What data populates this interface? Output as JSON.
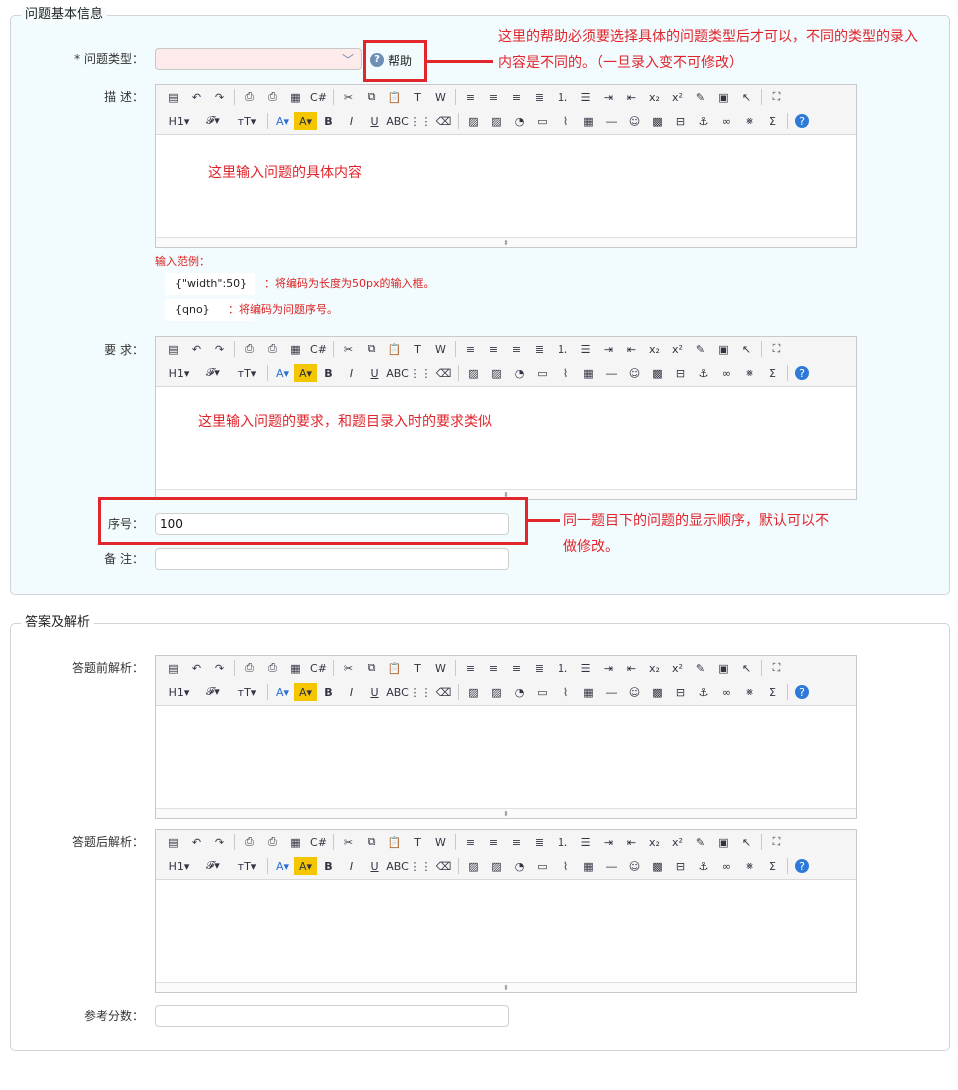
{
  "section1": {
    "legend": "问题基本信息",
    "type_label": "* 问题类型：",
    "help_label": "帮助",
    "help_icon": "question-circle-icon",
    "desc_label": "描 述：",
    "desc_annotation": "这里输入问题的具体内容",
    "sample_title": "输入范例：",
    "samples": [
      {
        "code": "{\"width\":50}",
        "desc": "：将编码为长度为50px的输入框。"
      },
      {
        "code": "{qno}",
        "desc": "：将编码为问题序号。"
      }
    ],
    "req_label": "要 求：",
    "req_annotation": "这里输入问题的要求，和题目录入时的要求类似",
    "order_label": "序号：",
    "order_value": "100",
    "remark_label": "备 注："
  },
  "section2": {
    "legend": "答案及解析",
    "pre_label": "答题前解析：",
    "post_label": "答题后解析：",
    "score_label": "参考分数："
  },
  "annotations": {
    "help_note": "这里的帮助必须要选择具体的问题类型后才可以，不同的类型的录入内容是不同的。（一旦录入变不可修改）",
    "order_note": "同一题目下的问题的显示顺序，默认可以不做修改。"
  },
  "toolbar": {
    "row1": [
      "source-icon",
      "undo-icon",
      "redo-icon",
      "|",
      "preview-icon",
      "print-icon",
      "template-icon",
      "code-icon",
      "|",
      "cut-icon",
      "copy-icon",
      "paste-icon",
      "paste-text-icon",
      "paste-word-icon",
      "|",
      "align-left-icon",
      "align-center-icon",
      "align-right-icon",
      "justify-icon",
      "ordered-list-icon",
      "unordered-list-icon",
      "indent-icon",
      "outdent-icon",
      "subscript-icon",
      "superscript-icon",
      "clear-format-icon",
      "select-all-icon",
      "pointer-icon",
      "|",
      "fullscreen-icon"
    ],
    "row2": [
      "heading-icon",
      "font-family-icon",
      "font-size-icon",
      "|",
      "font-color-icon",
      "highlight-icon",
      "bold-icon",
      "italic-icon",
      "underline-icon",
      "strikethrough-icon",
      "line-height-icon",
      "eraser-icon",
      "|",
      "image-icon",
      "multi-image-icon",
      "flash-icon",
      "media-icon",
      "attachment-icon",
      "table-icon",
      "hr-icon",
      "emoticon-icon",
      "baidu-map-icon",
      "page-break-icon",
      "anchor-icon",
      "link-icon",
      "unlink-icon",
      "formula-icon",
      "|",
      "about-icon"
    ]
  },
  "colors": {
    "accent_red": "#e1262c",
    "panel_bg": "#f2fbfd",
    "select_bg": "#fdebeb"
  }
}
